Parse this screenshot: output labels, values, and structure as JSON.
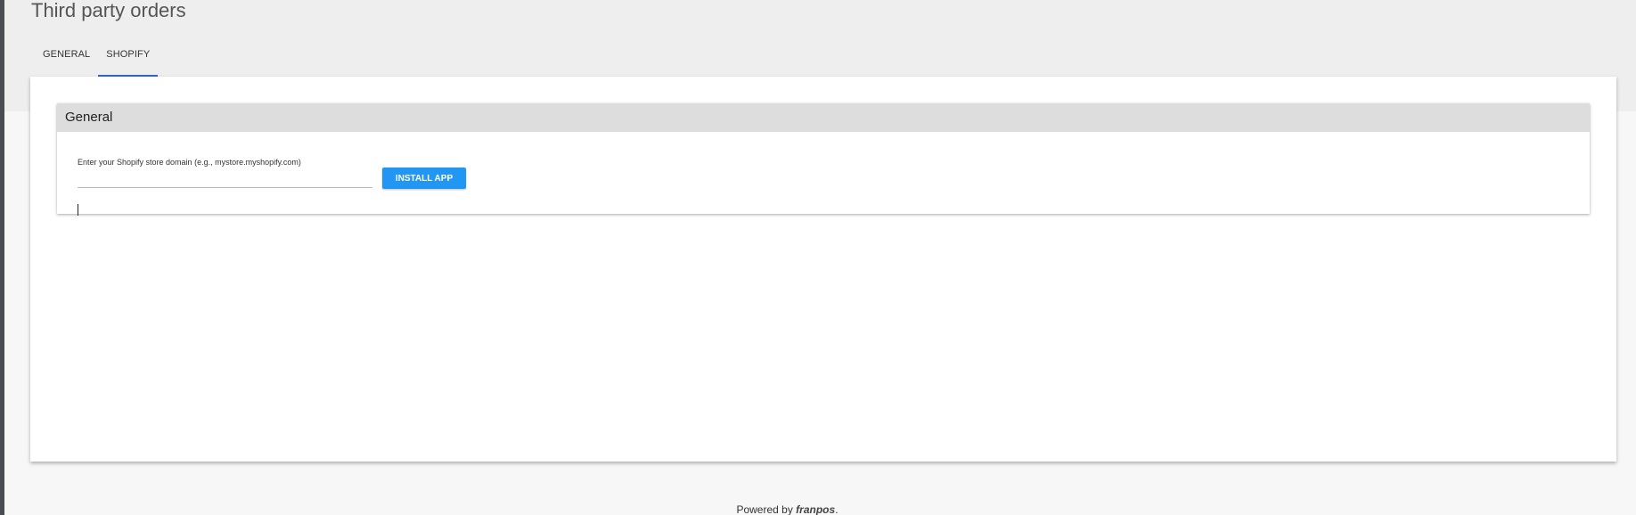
{
  "page": {
    "title": "Third party orders"
  },
  "tabs": [
    {
      "label": "GENERAL",
      "active": false
    },
    {
      "label": "SHOPIFY",
      "active": true
    }
  ],
  "panel": {
    "title": "General",
    "domain_label": "Enter your Shopify store domain (e.g., mystore.myshopify.com)",
    "domain_value": "",
    "install_button_label": "INSTALL APP"
  },
  "footer": {
    "powered_by": "Powered by",
    "brand": "franpos",
    "suffix": "."
  },
  "colors": {
    "accent": "#2196f3",
    "tab_indicator": "#2f64d3",
    "header_background": "#eeeeee",
    "panel_header_background": "#dddddd"
  }
}
